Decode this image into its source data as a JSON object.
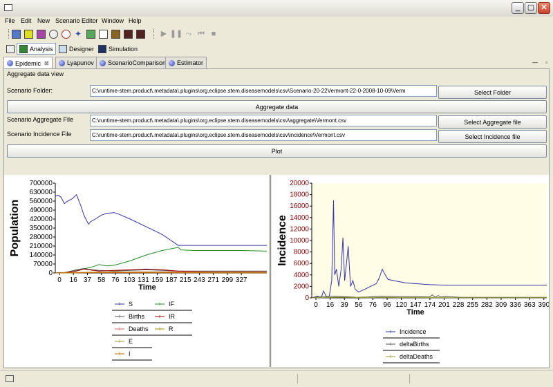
{
  "window": {
    "minimize_label": "_",
    "maximize_label": "▢",
    "close_label": "✕"
  },
  "menu": [
    "File",
    "Edit",
    "New",
    "Scenario Editor",
    "Window",
    "Help"
  ],
  "perspectives": [
    "Analysis",
    "Designer",
    "Simulation"
  ],
  "tabs": [
    {
      "label": "Epidemic",
      "close": "⊠"
    },
    {
      "label": "Lyapunov"
    },
    {
      "label": "ScenarioComparison"
    },
    {
      "label": "Estimator"
    }
  ],
  "view": {
    "title": "Aggregate data view",
    "folder_label": "Scenario Folder:",
    "folder_value": "C:\\runtime-stem.product\\.metadata\\.plugins\\org.eclipse.stem.diseasemodels\\csv\\Scenario-20-22Vermont-22-0-2008-10-09\\Verm",
    "select_folder": "Select Folder",
    "aggregate_button": "Aggregate data",
    "aggregate_file_label": "Scenario Aggregate File",
    "aggregate_file_value": "C:\\runtime-stem.product\\.metadata\\.plugins\\org.eclipse.stem.diseasemodels\\csv\\aggregate\\Vermont.csv",
    "select_aggregate": "Select Aggregate file",
    "incidence_file_label": "Scenario Incidence File",
    "incidence_file_value": "C:\\runtime-stem.product\\.metadata\\.plugins\\org.eclipse.stem.diseasemodels\\csv\\incidence\\Vermont.csv",
    "select_incidence": "Select Incidence file",
    "plot_button": "Plot"
  },
  "chart_data": [
    {
      "type": "line",
      "ylabel": "Population",
      "xlabel": "Time",
      "ylim": [
        0,
        700000
      ],
      "yticks": [
        "700000",
        "630000",
        "560000",
        "490000",
        "420000",
        "350000",
        "280000",
        "210000",
        "140000",
        "70000",
        "0"
      ],
      "xlim": [
        0,
        370
      ],
      "xticks": [
        "0",
        "16",
        "37",
        "58",
        "76",
        "103",
        "131",
        "159",
        "187",
        "215",
        "243",
        "271",
        "299",
        "327"
      ],
      "grid": false,
      "legend_position": "bottom",
      "legend": [
        "S",
        "IF",
        "Births",
        "IR",
        "Deaths",
        "R",
        "E",
        "I"
      ],
      "series": [
        {
          "name": "S",
          "color": "#3333aa",
          "x": [
            0,
            5,
            10,
            16,
            20,
            30,
            37,
            45,
            50,
            58,
            62,
            70,
            80,
            90,
            103,
            110,
            131,
            159,
            187,
            215,
            243,
            271,
            299,
            327,
            370
          ],
          "y": [
            600000,
            605000,
            590000,
            540000,
            555000,
            580000,
            610000,
            520000,
            450000,
            380000,
            400000,
            420000,
            450000,
            465000,
            470000,
            460000,
            420000,
            360000,
            300000,
            215000,
            215000,
            215000,
            215000,
            215000,
            215000
          ]
        },
        {
          "name": "IF",
          "color": "#228b22",
          "x": [
            0,
            16,
            30,
            37,
            45,
            58,
            70,
            76,
            90,
            103,
            131,
            159,
            187,
            215,
            220,
            243,
            271,
            299,
            327,
            370
          ],
          "y": [
            2000,
            3000,
            10000,
            20000,
            30000,
            40000,
            55000,
            65000,
            55000,
            60000,
            95000,
            140000,
            175000,
            200000,
            180000,
            175000,
            175000,
            175000,
            175000,
            170000
          ]
        },
        {
          "name": "Births",
          "color": "#555555",
          "x": [
            0,
            16,
            37,
            50,
            58,
            76,
            103,
            131,
            159,
            187,
            215,
            243,
            271,
            299,
            327,
            370
          ],
          "y": [
            0,
            2000,
            25000,
            35000,
            28000,
            20000,
            15000,
            20000,
            25000,
            20000,
            15000,
            15000,
            15000,
            15000,
            15000,
            15000
          ]
        },
        {
          "name": "IR",
          "color": "#aa0000",
          "x": [
            0,
            16,
            37,
            50,
            58,
            76,
            103,
            131,
            159,
            187,
            215,
            243,
            271,
            299,
            327,
            370
          ],
          "y": [
            0,
            1000,
            15000,
            30000,
            25000,
            15000,
            20000,
            25000,
            30000,
            25000,
            15000,
            12000,
            10000,
            10000,
            10000,
            10000
          ]
        },
        {
          "name": "Deaths",
          "color": "#cc6666",
          "x": [
            0,
            37,
            58,
            103,
            187,
            215,
            370
          ],
          "y": [
            0,
            2000,
            5000,
            8000,
            9000,
            9000,
            9000
          ]
        },
        {
          "name": "R",
          "color": "#aa8800",
          "x": [
            0,
            37,
            58,
            103,
            187,
            215,
            370
          ],
          "y": [
            0,
            3000,
            6000,
            7000,
            6000,
            5000,
            5000
          ]
        },
        {
          "name": "E",
          "color": "#999933",
          "x": [
            0,
            37,
            58,
            103,
            187,
            215,
            370
          ],
          "y": [
            0,
            1500,
            3000,
            4000,
            3500,
            3000,
            3000
          ]
        },
        {
          "name": "I",
          "color": "#cc6600",
          "x": [
            0,
            37,
            58,
            103,
            187,
            215,
            370
          ],
          "y": [
            0,
            1000,
            2000,
            2500,
            2000,
            1500,
            1500
          ]
        }
      ]
    },
    {
      "type": "line",
      "ylabel": "Incidence",
      "xlabel": "Time",
      "ylim": [
        0,
        20000
      ],
      "yticks": [
        "20000",
        "18000",
        "16000",
        "14000",
        "12000",
        "10000",
        "8000",
        "6000",
        "4000",
        "2000",
        "0"
      ],
      "xlim": [
        0,
        400
      ],
      "xticks": [
        "0",
        "16",
        "39",
        "56",
        "76",
        "96",
        "120",
        "147",
        "174",
        "201",
        "228",
        "255",
        "282",
        "309",
        "336",
        "363",
        "390"
      ],
      "grid": false,
      "background": "#fffde6",
      "legend_position": "bottom",
      "legend": [
        "Incidence",
        "deltaBirths",
        "deltaDeaths"
      ],
      "series": [
        {
          "name": "Incidence",
          "color": "#3333aa",
          "x": [
            0,
            10,
            16,
            20,
            26,
            30,
            34,
            37,
            39,
            42,
            46,
            50,
            53,
            56,
            59,
            62,
            66,
            70,
            74,
            80,
            90,
            100,
            110,
            115,
            120,
            125,
            130,
            140,
            150,
            160,
            174,
            201,
            228,
            255,
            282,
            309,
            336,
            363,
            390,
            400
          ],
          "y": [
            0,
            300,
            0,
            1200,
            0,
            400,
            3000,
            17000,
            4000,
            5000,
            2000,
            5000,
            10500,
            3000,
            6000,
            9000,
            2000,
            3000,
            1500,
            1000,
            1500,
            2000,
            2500,
            3500,
            5000,
            4000,
            3200,
            3000,
            2800,
            2600,
            2500,
            2300,
            2200,
            2200,
            2200,
            2200,
            2200,
            2200,
            2200,
            2200
          ]
        },
        {
          "name": "deltaBirths",
          "color": "#555555",
          "x": [
            0,
            16,
            39,
            56,
            76,
            96,
            120,
            147,
            174,
            201,
            205,
            210,
            215,
            220,
            228,
            255,
            282,
            309,
            336,
            363,
            390,
            400
          ],
          "y": [
            0,
            200,
            300,
            200,
            100,
            150,
            300,
            200,
            200,
            150,
            500,
            100,
            400,
            150,
            200,
            100,
            100,
            100,
            100,
            100,
            100,
            100
          ]
        },
        {
          "name": "deltaDeaths",
          "color": "#999933",
          "x": [
            0,
            16,
            39,
            56,
            76,
            96,
            120,
            147,
            174,
            201,
            228,
            255,
            282,
            309,
            336,
            363,
            390,
            400
          ],
          "y": [
            0,
            50,
            100,
            80,
            60,
            50,
            80,
            60,
            60,
            50,
            50,
            40,
            40,
            40,
            40,
            40,
            40,
            40
          ]
        }
      ]
    }
  ]
}
